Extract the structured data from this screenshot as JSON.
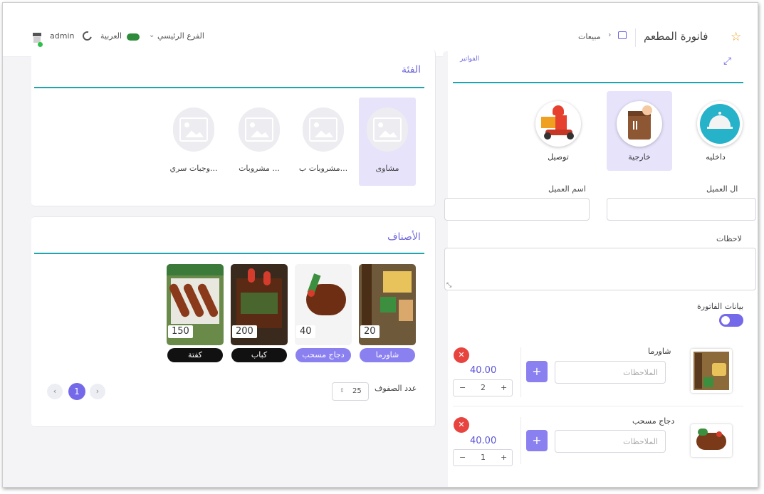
{
  "header": {
    "title": "فانورة المطعم",
    "breadcrumb_current": "مبيعات",
    "branch": "الفرع الرئيسي",
    "language": "العربية",
    "user": "admin"
  },
  "invoices_link": "الفواتير",
  "categories": {
    "title": "الفئة",
    "items": [
      {
        "label": "مشاوى"
      },
      {
        "label": "مشروبات ب..."
      },
      {
        "label": "مشروبات ..."
      },
      {
        "label": "وجبات سري..."
      }
    ]
  },
  "order_types": [
    {
      "label": "داخليه"
    },
    {
      "label": "خارجية"
    },
    {
      "label": "توصيل"
    }
  ],
  "customer": {
    "phone_label": "ال العميل",
    "name_label": "اسم العميل",
    "notes_label": "لاحظات",
    "invoice_data_label": "بيانات الفاتورة"
  },
  "products": {
    "title": "الأصناف",
    "items": [
      {
        "name": "شاورما",
        "price": "20",
        "style": "purple"
      },
      {
        "name": "دجاج مسحب",
        "price": "40",
        "style": "purple"
      },
      {
        "name": "كباب",
        "price": "200",
        "style": "black"
      },
      {
        "name": "كفتة",
        "price": "150",
        "style": "black"
      }
    ],
    "rows_label": "عدد الصفوف",
    "rows_value": "25",
    "current_page": "1"
  },
  "cart": {
    "note_placeholder": "الملاحظات",
    "items": [
      {
        "name": "شاورما",
        "price": "40.00",
        "qty": "2"
      },
      {
        "name": "دجاج مسحب",
        "price": "40.00",
        "qty": "1"
      }
    ]
  },
  "colors": {
    "accent": "#7469e8",
    "teal": "#1ea5b0",
    "danger": "#e8443f"
  }
}
